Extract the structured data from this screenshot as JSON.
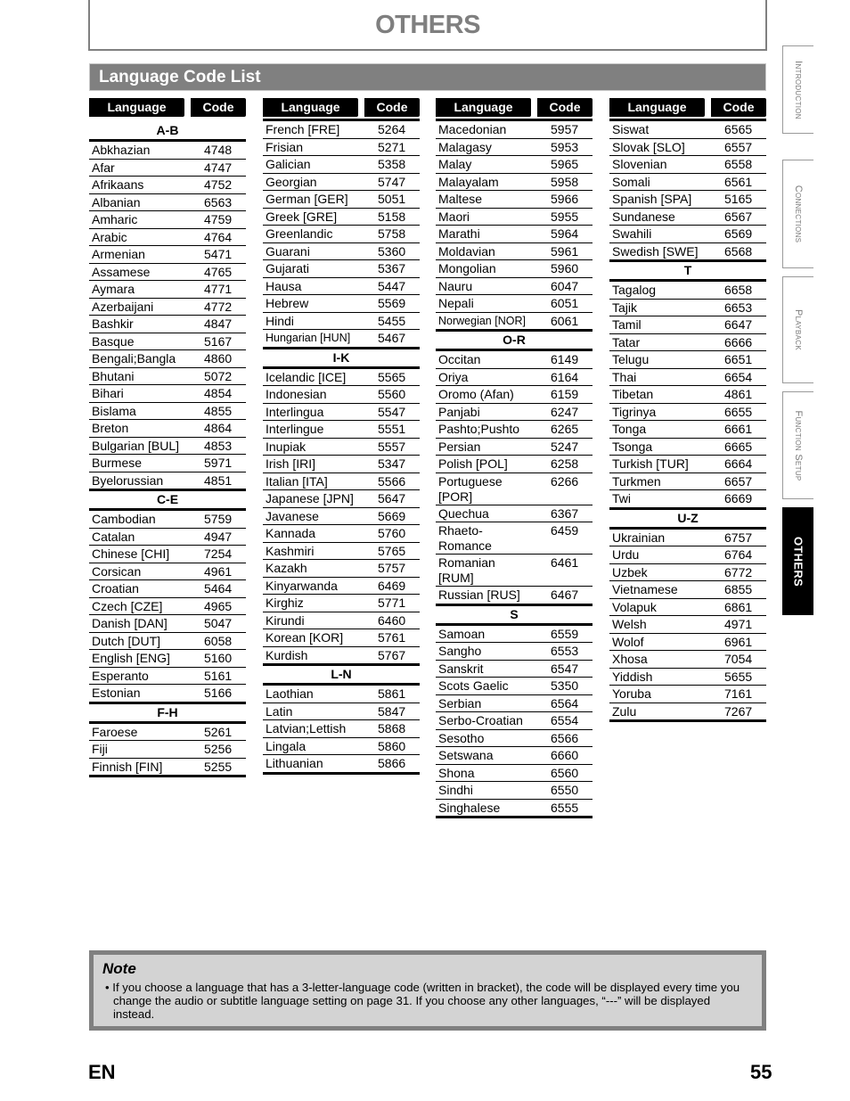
{
  "header": {
    "title": "OTHERS"
  },
  "section": {
    "title": "Language Code List"
  },
  "table_headers": {
    "language": "Language",
    "code": "Code"
  },
  "columns": [
    {
      "groups": [
        {
          "label": "A-B",
          "rows": [
            [
              "Abkhazian",
              "4748"
            ],
            [
              "Afar",
              "4747"
            ],
            [
              "Afrikaans",
              "4752"
            ],
            [
              "Albanian",
              "6563"
            ],
            [
              "Amharic",
              "4759"
            ],
            [
              "Arabic",
              "4764"
            ],
            [
              "Armenian",
              "5471"
            ],
            [
              "Assamese",
              "4765"
            ],
            [
              "Aymara",
              "4771"
            ],
            [
              "Azerbaijani",
              "4772"
            ],
            [
              "Bashkir",
              "4847"
            ],
            [
              "Basque",
              "5167"
            ],
            [
              "Bengali;Bangla",
              "4860"
            ],
            [
              "Bhutani",
              "5072"
            ],
            [
              "Bihari",
              "4854"
            ],
            [
              "Bislama",
              "4855"
            ],
            [
              "Breton",
              "4864"
            ],
            [
              "Bulgarian [BUL]",
              "4853"
            ],
            [
              "Burmese",
              "5971"
            ],
            [
              "Byelorussian",
              "4851"
            ]
          ]
        },
        {
          "label": "C-E",
          "rows": [
            [
              "Cambodian",
              "5759"
            ],
            [
              "Catalan",
              "4947"
            ],
            [
              "Chinese [CHI]",
              "7254"
            ],
            [
              "Corsican",
              "4961"
            ],
            [
              "Croatian",
              "5464"
            ],
            [
              "Czech [CZE]",
              "4965"
            ],
            [
              "Danish [DAN]",
              "5047"
            ],
            [
              "Dutch [DUT]",
              "6058"
            ],
            [
              "English [ENG]",
              "5160"
            ],
            [
              "Esperanto",
              "5161"
            ],
            [
              "Estonian",
              "5166"
            ]
          ]
        },
        {
          "label": "F-H",
          "rows": [
            [
              "Faroese",
              "5261"
            ],
            [
              "Fiji",
              "5256"
            ],
            [
              "Finnish [FIN]",
              "5255"
            ]
          ]
        }
      ]
    },
    {
      "groups": [
        {
          "label": "",
          "rows": [
            [
              "French [FRE]",
              "5264"
            ],
            [
              "Frisian",
              "5271"
            ],
            [
              "Galician",
              "5358"
            ],
            [
              "Georgian",
              "5747"
            ],
            [
              "German [GER]",
              "5051"
            ],
            [
              "Greek [GRE]",
              "5158"
            ],
            [
              "Greenlandic",
              "5758"
            ],
            [
              "Guarani",
              "5360"
            ],
            [
              "Gujarati",
              "5367"
            ],
            [
              "Hausa",
              "5447"
            ],
            [
              "Hebrew",
              "5569"
            ],
            [
              "Hindi",
              "5455"
            ],
            [
              "Hungarian [HUN]",
              "5467"
            ]
          ]
        },
        {
          "label": "I-K",
          "rows": [
            [
              "Icelandic [ICE]",
              "5565"
            ],
            [
              "Indonesian",
              "5560"
            ],
            [
              "Interlingua",
              "5547"
            ],
            [
              "Interlingue",
              "5551"
            ],
            [
              "Inupiak",
              "5557"
            ],
            [
              "Irish [IRI]",
              "5347"
            ],
            [
              "Italian [ITA]",
              "5566"
            ],
            [
              "Japanese [JPN]",
              "5647"
            ],
            [
              "Javanese",
              "5669"
            ],
            [
              "Kannada",
              "5760"
            ],
            [
              "Kashmiri",
              "5765"
            ],
            [
              "Kazakh",
              "5757"
            ],
            [
              "Kinyarwanda",
              "6469"
            ],
            [
              "Kirghiz",
              "5771"
            ],
            [
              "Kirundi",
              "6460"
            ],
            [
              "Korean [KOR]",
              "5761"
            ],
            [
              "Kurdish",
              "5767"
            ]
          ]
        },
        {
          "label": "L-N",
          "rows": [
            [
              "Laothian",
              "5861"
            ],
            [
              "Latin",
              "5847"
            ],
            [
              "Latvian;Lettish",
              "5868"
            ],
            [
              "Lingala",
              "5860"
            ],
            [
              "Lithuanian",
              "5866"
            ]
          ]
        }
      ]
    },
    {
      "groups": [
        {
          "label": "",
          "rows": [
            [
              "Macedonian",
              "5957"
            ],
            [
              "Malagasy",
              "5953"
            ],
            [
              "Malay",
              "5965"
            ],
            [
              "Malayalam",
              "5958"
            ],
            [
              "Maltese",
              "5966"
            ],
            [
              "Maori",
              "5955"
            ],
            [
              "Marathi",
              "5964"
            ],
            [
              "Moldavian",
              "5961"
            ],
            [
              "Mongolian",
              "5960"
            ],
            [
              "Nauru",
              "6047"
            ],
            [
              "Nepali",
              "6051"
            ],
            [
              "Norwegian [NOR]",
              "6061"
            ]
          ]
        },
        {
          "label": "O-R",
          "rows": [
            [
              "Occitan",
              "6149"
            ],
            [
              "Oriya",
              "6164"
            ],
            [
              "Oromo (Afan)",
              "6159"
            ],
            [
              "Panjabi",
              "6247"
            ],
            [
              "Pashto;Pushto",
              "6265"
            ],
            [
              "Persian",
              "5247"
            ],
            [
              "Polish [POL]",
              "6258"
            ],
            [
              "Portuguese [POR]",
              "6266"
            ],
            [
              "Quechua",
              "6367"
            ],
            [
              "Rhaeto-Romance",
              "6459"
            ],
            [
              "Romanian [RUM]",
              "6461"
            ],
            [
              "Russian [RUS]",
              "6467"
            ]
          ]
        },
        {
          "label": "S",
          "rows": [
            [
              "Samoan",
              "6559"
            ],
            [
              "Sangho",
              "6553"
            ],
            [
              "Sanskrit",
              "6547"
            ],
            [
              "Scots Gaelic",
              "5350"
            ],
            [
              "Serbian",
              "6564"
            ],
            [
              "Serbo-Croatian",
              "6554"
            ],
            [
              "Sesotho",
              "6566"
            ],
            [
              "Setswana",
              "6660"
            ],
            [
              "Shona",
              "6560"
            ],
            [
              "Sindhi",
              "6550"
            ],
            [
              "Singhalese",
              "6555"
            ]
          ]
        }
      ]
    },
    {
      "groups": [
        {
          "label": "",
          "rows": [
            [
              "Siswat",
              "6565"
            ],
            [
              "Slovak [SLO]",
              "6557"
            ],
            [
              "Slovenian",
              "6558"
            ],
            [
              "Somali",
              "6561"
            ],
            [
              "Spanish [SPA]",
              "5165"
            ],
            [
              "Sundanese",
              "6567"
            ],
            [
              "Swahili",
              "6569"
            ],
            [
              "Swedish [SWE]",
              "6568"
            ]
          ]
        },
        {
          "label": "T",
          "rows": [
            [
              "Tagalog",
              "6658"
            ],
            [
              "Tajik",
              "6653"
            ],
            [
              "Tamil",
              "6647"
            ],
            [
              "Tatar",
              "6666"
            ],
            [
              "Telugu",
              "6651"
            ],
            [
              "Thai",
              "6654"
            ],
            [
              "Tibetan",
              "4861"
            ],
            [
              "Tigrinya",
              "6655"
            ],
            [
              "Tonga",
              "6661"
            ],
            [
              "Tsonga",
              "6665"
            ],
            [
              "Turkish [TUR]",
              "6664"
            ],
            [
              "Turkmen",
              "6657"
            ],
            [
              "Twi",
              "6669"
            ]
          ]
        },
        {
          "label": "U-Z",
          "rows": [
            [
              "Ukrainian",
              "6757"
            ],
            [
              "Urdu",
              "6764"
            ],
            [
              "Uzbek",
              "6772"
            ],
            [
              "Vietnamese",
              "6855"
            ],
            [
              "Volapuk",
              "6861"
            ],
            [
              "Welsh",
              "4971"
            ],
            [
              "Wolof",
              "6961"
            ],
            [
              "Xhosa",
              "7054"
            ],
            [
              "Yiddish",
              "5655"
            ],
            [
              "Yoruba",
              "7161"
            ],
            [
              "Zulu",
              "7267"
            ]
          ]
        }
      ]
    }
  ],
  "side_tabs": [
    {
      "label": "Introduction",
      "active": false
    },
    {
      "label": "Connections",
      "active": false
    },
    {
      "label": "Playback",
      "active": false
    },
    {
      "label": "Function Setup",
      "active": false
    },
    {
      "label": "OTHERS",
      "active": true
    }
  ],
  "note": {
    "title": "Note",
    "text": "• If you choose a language that has a 3-letter-language code (written in bracket), the code will be displayed every time you change the audio or subtitle language setting on page 31. If you choose any other languages, “---” will be displayed instead."
  },
  "footer": {
    "language": "EN",
    "page_number": "55"
  }
}
